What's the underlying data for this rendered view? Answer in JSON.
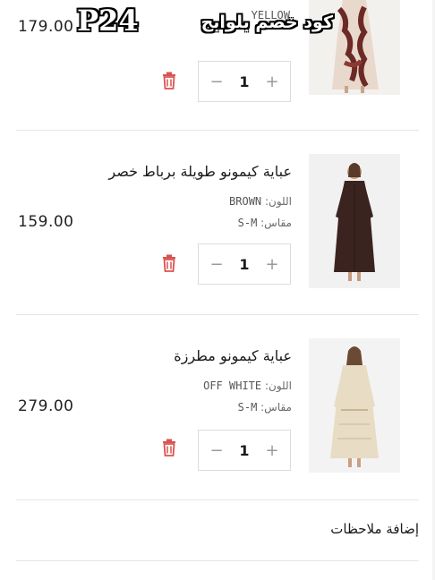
{
  "overlay": {
    "promo_code": "P24",
    "promo_caption": "كود خصم بلوابج"
  },
  "items": [
    {
      "title": "",
      "price": "179.00",
      "color_label": "",
      "color_value": "YELLOW",
      "size_label": "",
      "size_value": "",
      "quantity": "1",
      "image_icon": "floral-dress-photo"
    },
    {
      "title": "عباية كيمونو طويلة برباط خصر",
      "price": "159.00",
      "color_label": "اللون:",
      "color_value": "BROWN",
      "size_label": "مقاس:",
      "size_value": "S-M",
      "quantity": "1",
      "image_icon": "brown-abaya-photo"
    },
    {
      "title": "عباية كيمونو مطرزة",
      "price": "279.00",
      "color_label": "اللون:",
      "color_value": "OFF WHITE",
      "size_label": "مقاس:",
      "size_value": "S-M",
      "quantity": "1",
      "image_icon": "offwhite-abaya-photo"
    }
  ],
  "stepper": {
    "minus": "−",
    "plus": "+"
  },
  "notes_label": "إضافة ملاحظات",
  "colors": {
    "trash": "#d9534f",
    "border": "#dcdcdc"
  }
}
